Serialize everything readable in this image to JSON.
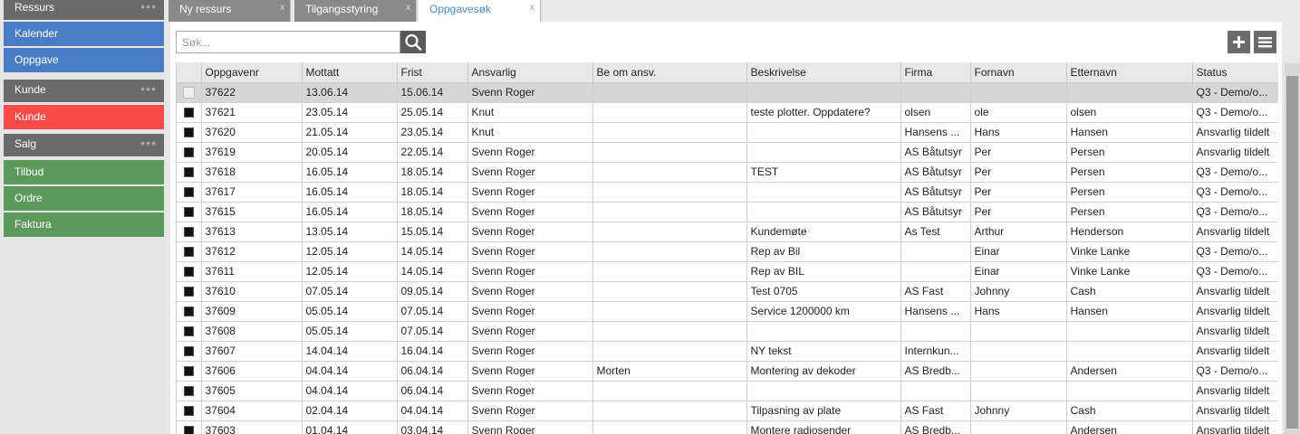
{
  "sidebar": {
    "groups": [
      {
        "label": "Ressurs",
        "items": [
          {
            "label": "Kalender",
            "color": "#4a7cc6"
          },
          {
            "label": "Oppgave",
            "color": "#4a7cc6"
          }
        ]
      },
      {
        "label": "Kunde",
        "items": [
          {
            "label": "Kunde",
            "color": "#fa4a4a"
          }
        ]
      },
      {
        "label": "Salg",
        "items": [
          {
            "label": "Tilbud",
            "color": "#5b9a5b"
          },
          {
            "label": "Ordre",
            "color": "#5b9a5b"
          },
          {
            "label": "Faktura",
            "color": "#5b9a5b"
          }
        ]
      }
    ],
    "dots": "•••"
  },
  "tabs": [
    {
      "label": "Ny ressurs",
      "close": "x",
      "active": false
    },
    {
      "label": "Tilgangsstyring",
      "close": "x",
      "active": false
    },
    {
      "label": "Oppgavesøk",
      "close": "x",
      "active": true
    }
  ],
  "search": {
    "placeholder": "Søk...",
    "value": "",
    "icon": "search-icon"
  },
  "toolbar": {
    "add_icon": "plus-icon",
    "menu_icon": "hamburger-icon"
  },
  "table": {
    "columns": [
      "",
      "Oppgavenr",
      "Mottatt",
      "Frist",
      "Ansvarlig",
      "Be om ansv.",
      "Beskrivelse",
      "Firma",
      "Fornavn",
      "Etternavn",
      "Status"
    ],
    "rows": [
      {
        "selected": true,
        "checked": false,
        "cells": [
          "37622",
          "13.06.14",
          "15.06.14",
          "Svenn Roger",
          "",
          "",
          "",
          "",
          "",
          "Q3 - Demo/o..."
        ]
      },
      {
        "selected": false,
        "checked": true,
        "cells": [
          "37621",
          "23.05.14",
          "25.05.14",
          "Knut",
          "",
          "teste plotter. Oppdatere?",
          "olsen",
          "ole",
          "olsen",
          "Q3 - Demo/o..."
        ]
      },
      {
        "selected": false,
        "checked": true,
        "cells": [
          "37620",
          "21.05.14",
          "23.05.14",
          "Knut",
          "",
          "",
          "Hansens ...",
          "Hans",
          "Hansen",
          "Ansvarlig tildelt"
        ]
      },
      {
        "selected": false,
        "checked": true,
        "cells": [
          "37619",
          "20.05.14",
          "22.05.14",
          "Svenn Roger",
          "",
          "",
          "AS Båtutsyr",
          "Per",
          "Persen",
          "Ansvarlig tildelt"
        ]
      },
      {
        "selected": false,
        "checked": true,
        "cells": [
          "37618",
          "16.05.14",
          "18.05.14",
          "Svenn Roger",
          "",
          "TEST",
          "AS Båtutsyr",
          "Per",
          "Persen",
          "Q3 - Demo/o..."
        ]
      },
      {
        "selected": false,
        "checked": true,
        "cells": [
          "37617",
          "16.05.14",
          "18.05.14",
          "Svenn Roger",
          "",
          "",
          "AS Båtutsyr",
          "Per",
          "Persen",
          "Q3 - Demo/o..."
        ]
      },
      {
        "selected": false,
        "checked": true,
        "cells": [
          "37615",
          "16.05.14",
          "18.05.14",
          "Svenn Roger",
          "",
          "",
          "AS Båtutsyr",
          "Per",
          "Persen",
          "Q3 - Demo/o..."
        ]
      },
      {
        "selected": false,
        "checked": true,
        "cells": [
          "37613",
          "13.05.14",
          "15.05.14",
          "Svenn Roger",
          "",
          "Kundemøte",
          "As Test",
          "Arthur",
          "Henderson",
          "Ansvarlig tildelt"
        ]
      },
      {
        "selected": false,
        "checked": true,
        "cells": [
          "37612",
          "12.05.14",
          "14.05.14",
          "Svenn Roger",
          "",
          "Rep av Bil",
          "",
          "Einar",
          "Vinke Lanke",
          "Q3 - Demo/o..."
        ]
      },
      {
        "selected": false,
        "checked": true,
        "cells": [
          "37611",
          "12.05.14",
          "14.05.14",
          "Svenn Roger",
          "",
          "Rep av BIL",
          "",
          "Einar",
          "Vinke Lanke",
          "Q3 - Demo/o..."
        ]
      },
      {
        "selected": false,
        "checked": true,
        "cells": [
          "37610",
          "07.05.14",
          "09.05.14",
          "Svenn Roger",
          "",
          "Test 0705",
          "AS Fast",
          "Johnny",
          "Cash",
          "Ansvarlig tildelt"
        ]
      },
      {
        "selected": false,
        "checked": true,
        "cells": [
          "37609",
          "05.05.14",
          "07.05.14",
          "Svenn Roger",
          "",
          "Service 1200000 km",
          "Hansens ...",
          "Hans",
          "Hansen",
          "Ansvarlig tildelt"
        ]
      },
      {
        "selected": false,
        "checked": true,
        "cells": [
          "37608",
          "05.05.14",
          "07.05.14",
          "Svenn Roger",
          "",
          "",
          "",
          "",
          "",
          "Ansvarlig tildelt"
        ]
      },
      {
        "selected": false,
        "checked": true,
        "cells": [
          "37607",
          "14.04.14",
          "16.04.14",
          "Svenn Roger",
          "",
          "NY tekst",
          "Internkun...",
          "",
          "",
          "Ansvarlig tildelt"
        ]
      },
      {
        "selected": false,
        "checked": true,
        "cells": [
          "37606",
          "04.04.14",
          "06.04.14",
          "Svenn Roger",
          "Morten",
          "Montering av dekoder",
          "AS Bredb...",
          "",
          "Andersen",
          "Q3 - Demo/o..."
        ]
      },
      {
        "selected": false,
        "checked": true,
        "cells": [
          "37605",
          "04.04.14",
          "06.04.14",
          "Svenn Roger",
          "",
          "",
          "",
          "",
          "",
          "Ansvarlig tildelt"
        ]
      },
      {
        "selected": false,
        "checked": true,
        "cells": [
          "37604",
          "02.04.14",
          "04.04.14",
          "Svenn Roger",
          "",
          "Tilpasning av plate",
          "AS Fast",
          "Johnny",
          "Cash",
          "Ansvarlig tildelt"
        ]
      },
      {
        "selected": false,
        "checked": true,
        "cells": [
          "37603",
          "01.04.14",
          "03.04.14",
          "Svenn Roger",
          "",
          "Montere radiosender",
          "AS Bredb...",
          "",
          "Andersen",
          "Ansvarlig tildelt"
        ]
      }
    ]
  }
}
